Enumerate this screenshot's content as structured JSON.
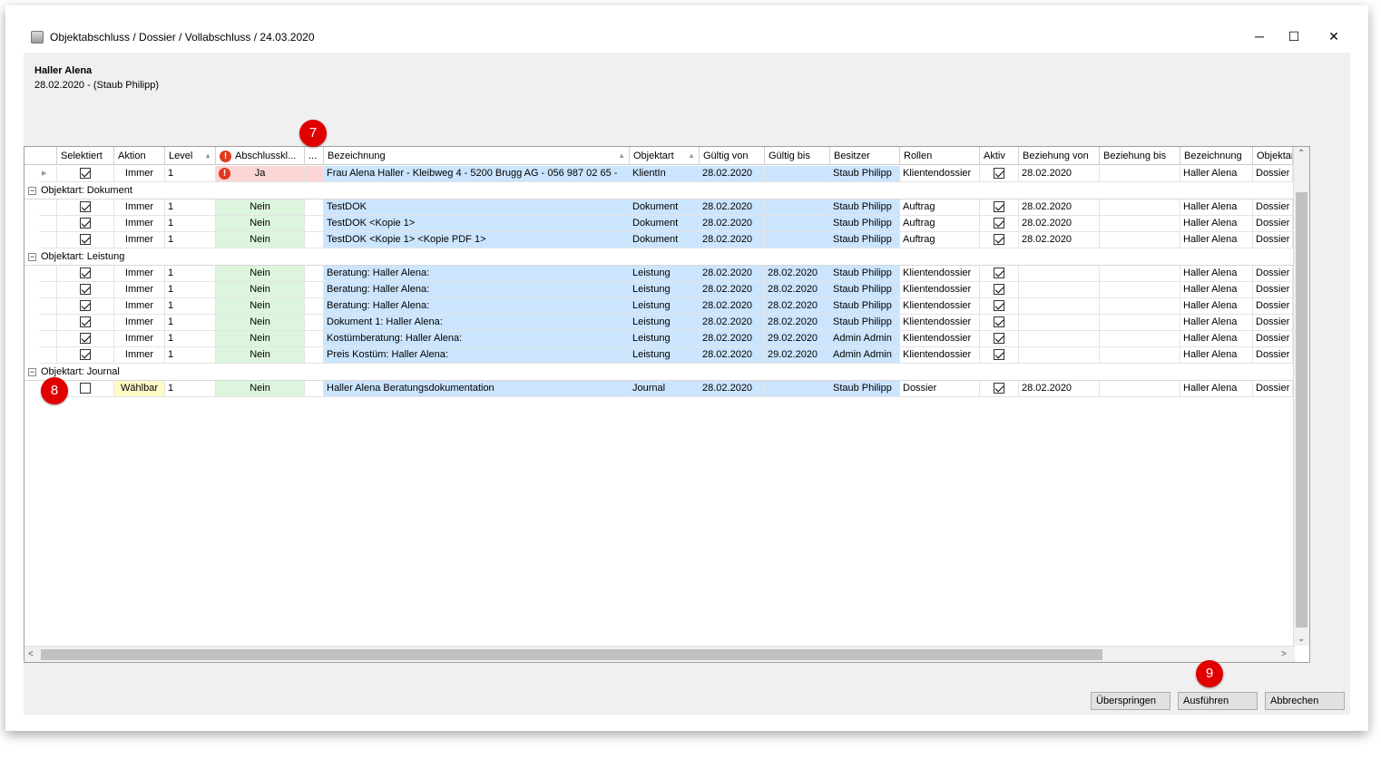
{
  "window": {
    "title": "Objektabschluss / Dossier / Vollabschluss / 24.03.2020",
    "minimize_glyph": "─",
    "maximize_glyph": "☐",
    "close_glyph": "✕"
  },
  "owner": {
    "name": "Haller Alena",
    "date_line": "28.02.2020 -  (Staub Philipp)"
  },
  "columns": [
    "Selektiert",
    "Aktion",
    "Level",
    "Abschlusskl...",
    "...",
    "Bezeichnung",
    "Objektart",
    "Gültig von",
    "Gültig bis",
    "Besitzer",
    "Rollen",
    "Aktiv",
    "Beziehung von",
    "Beziehung bis",
    "Bezeichnung",
    "Objektar"
  ],
  "top_row": {
    "selected": true,
    "aktion": "Immer",
    "level": "1",
    "abschluss": "Ja",
    "bezeichnung": "Frau Alena Haller -  Kleibweg 4 -  5200 Brugg AG -  056 987 02 65 -",
    "objektart": "KlientIn",
    "gueltig_von": "28.02.2020",
    "gueltig_bis": "",
    "besitzer": "Staub Philipp",
    "rollen": "Klientendossier",
    "aktiv": true,
    "beziehung_von": "28.02.2020",
    "beziehung_bis": "",
    "bezeichnung2": "Haller Alena",
    "objektar": "Dossier"
  },
  "groups": [
    {
      "label": "Objektart:  Dokument",
      "rows": [
        {
          "selected": true,
          "aktion": "Immer",
          "level": "1",
          "abschluss": "Nein",
          "bezeichnung": "TestDOK",
          "objektart": "Dokument",
          "gueltig_von": "28.02.2020",
          "gueltig_bis": "",
          "besitzer": "Staub Philipp",
          "rollen": "Auftrag",
          "aktiv": true,
          "beziehung_von": "28.02.2020",
          "beziehung_bis": "",
          "bezeichnung2": "Haller Alena",
          "objektar": "Dossier"
        },
        {
          "selected": true,
          "aktion": "Immer",
          "level": "1",
          "abschluss": "Nein",
          "bezeichnung": "TestDOK <Kopie 1>",
          "objektart": "Dokument",
          "gueltig_von": "28.02.2020",
          "gueltig_bis": "",
          "besitzer": "Staub Philipp",
          "rollen": "Auftrag",
          "aktiv": true,
          "beziehung_von": "28.02.2020",
          "beziehung_bis": "",
          "bezeichnung2": "Haller Alena",
          "objektar": "Dossier"
        },
        {
          "selected": true,
          "aktion": "Immer",
          "level": "1",
          "abschluss": "Nein",
          "bezeichnung": "TestDOK <Kopie 1> <Kopie PDF 1>",
          "objektart": "Dokument",
          "gueltig_von": "28.02.2020",
          "gueltig_bis": "",
          "besitzer": "Staub Philipp",
          "rollen": "Auftrag",
          "aktiv": true,
          "beziehung_von": "28.02.2020",
          "beziehung_bis": "",
          "bezeichnung2": "Haller Alena",
          "objektar": "Dossier"
        }
      ]
    },
    {
      "label": "Objektart:  Leistung",
      "rows": [
        {
          "selected": true,
          "aktion": "Immer",
          "level": "1",
          "abschluss": "Nein",
          "bezeichnung": "Beratung:  Haller Alena:",
          "objektart": "Leistung",
          "gueltig_von": "28.02.2020",
          "gueltig_bis": "28.02.2020",
          "besitzer": "Staub Philipp",
          "rollen": "Klientendossier",
          "aktiv": true,
          "beziehung_von": "",
          "beziehung_bis": "",
          "bezeichnung2": "Haller Alena",
          "objektar": "Dossier"
        },
        {
          "selected": true,
          "aktion": "Immer",
          "level": "1",
          "abschluss": "Nein",
          "bezeichnung": "Beratung:  Haller Alena:",
          "objektart": "Leistung",
          "gueltig_von": "28.02.2020",
          "gueltig_bis": "28.02.2020",
          "besitzer": "Staub Philipp",
          "rollen": "Klientendossier",
          "aktiv": true,
          "beziehung_von": "",
          "beziehung_bis": "",
          "bezeichnung2": "Haller Alena",
          "objektar": "Dossier"
        },
        {
          "selected": true,
          "aktion": "Immer",
          "level": "1",
          "abschluss": "Nein",
          "bezeichnung": "Beratung:  Haller Alena:",
          "objektart": "Leistung",
          "gueltig_von": "28.02.2020",
          "gueltig_bis": "28.02.2020",
          "besitzer": "Staub Philipp",
          "rollen": "Klientendossier",
          "aktiv": true,
          "beziehung_von": "",
          "beziehung_bis": "",
          "bezeichnung2": "Haller Alena",
          "objektar": "Dossier"
        },
        {
          "selected": true,
          "aktion": "Immer",
          "level": "1",
          "abschluss": "Nein",
          "bezeichnung": "Dokument 1:  Haller Alena:",
          "objektart": "Leistung",
          "gueltig_von": "28.02.2020",
          "gueltig_bis": "28.02.2020",
          "besitzer": "Staub Philipp",
          "rollen": "Klientendossier",
          "aktiv": true,
          "beziehung_von": "",
          "beziehung_bis": "",
          "bezeichnung2": "Haller Alena",
          "objektar": "Dossier"
        },
        {
          "selected": true,
          "aktion": "Immer",
          "level": "1",
          "abschluss": "Nein",
          "bezeichnung": "Kostümberatung:  Haller Alena:",
          "objektart": "Leistung",
          "gueltig_von": "28.02.2020",
          "gueltig_bis": "29.02.2020",
          "besitzer": "Admin Admin",
          "rollen": "Klientendossier",
          "aktiv": true,
          "beziehung_von": "",
          "beziehung_bis": "",
          "bezeichnung2": "Haller Alena",
          "objektar": "Dossier"
        },
        {
          "selected": true,
          "aktion": "Immer",
          "level": "1",
          "abschluss": "Nein",
          "bezeichnung": "Preis Kostüm:  Haller Alena:",
          "objektart": "Leistung",
          "gueltig_von": "28.02.2020",
          "gueltig_bis": "29.02.2020",
          "besitzer": "Admin Admin",
          "rollen": "Klientendossier",
          "aktiv": true,
          "beziehung_von": "",
          "beziehung_bis": "",
          "bezeichnung2": "Haller Alena",
          "objektar": "Dossier"
        }
      ]
    },
    {
      "label": "Objektart:  Journal",
      "rows": [
        {
          "selected": false,
          "aktion": "Wählbar",
          "level": "1",
          "abschluss": "Nein",
          "bezeichnung": "Haller Alena Beratungsdokumentation",
          "objektart": "Journal",
          "gueltig_von": "28.02.2020",
          "gueltig_bis": "",
          "besitzer": "Staub Philipp",
          "rollen": "Dossier",
          "aktiv": true,
          "beziehung_von": "28.02.2020",
          "beziehung_bis": "",
          "bezeichnung2": "Haller Alena",
          "objektar": "Dossier"
        }
      ]
    }
  ],
  "buttons": {
    "skip": "Überspringen",
    "execute": "Ausführen",
    "cancel": "Abbrechen"
  },
  "badges": {
    "b7": "7",
    "b8": "8",
    "b9": "9"
  },
  "colors": {
    "green": "#ddf5dd",
    "red": "#fcd6d6",
    "yellow": "#fffac8",
    "blue": "#cce5ff",
    "badge": "#e00000"
  }
}
